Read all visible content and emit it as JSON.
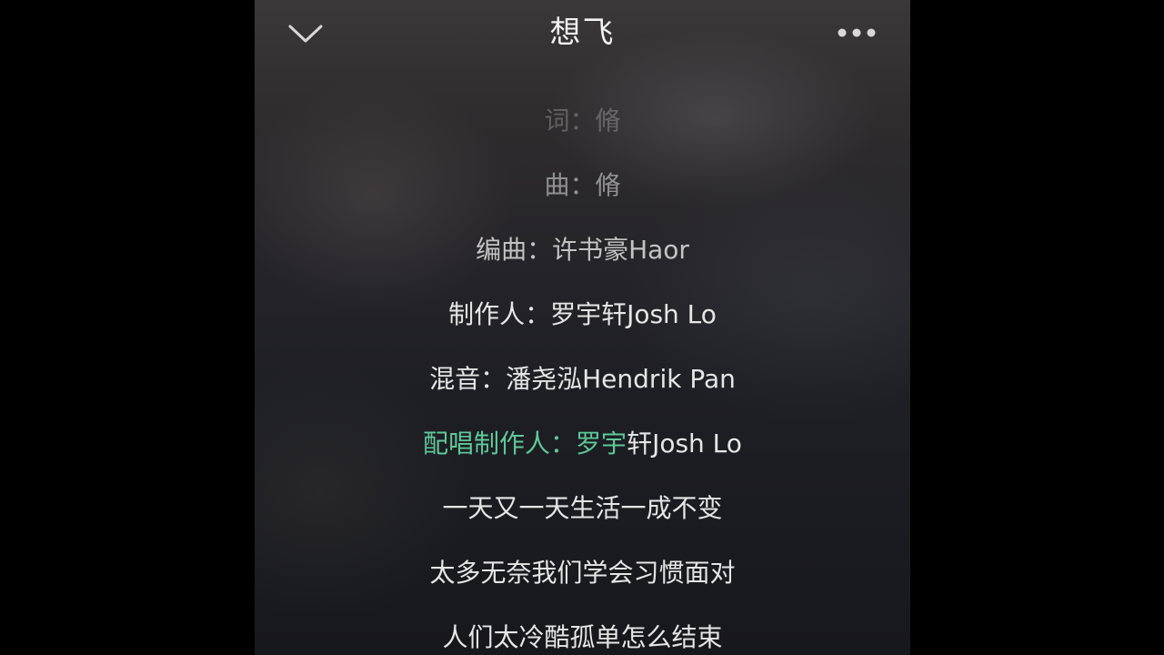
{
  "header": {
    "title": "想飞",
    "back_icon": "chevron-down-icon",
    "more_icon": "more-dots-icon"
  },
  "lyrics": {
    "lines": [
      "词：脩",
      "曲：脩",
      "编曲：许书豪Haor",
      "制作人：罗宇轩Josh Lo",
      "混音：潘尧泓Hendrik Pan",
      "一天又一天生活一成不变",
      "太多无奈我们学会习惯面对",
      "人们太冷酷孤单怎么结束"
    ],
    "current_line": {
      "sung": "配唱制作人：罗宇",
      "unsung": "轩Josh Lo"
    },
    "highlight_color": "#5fc89a"
  }
}
